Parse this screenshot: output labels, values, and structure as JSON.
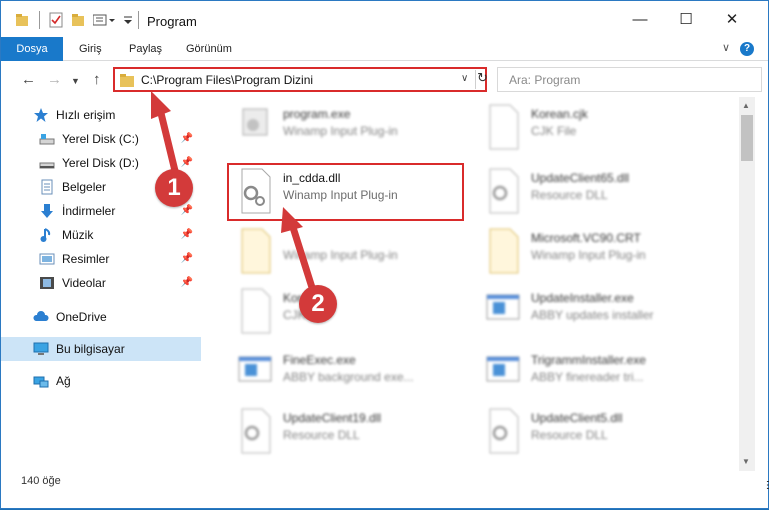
{
  "window": {
    "title": "Program"
  },
  "ribbon": {
    "tabs": [
      "Dosya",
      "Giriş",
      "Paylaş",
      "Görünüm"
    ]
  },
  "address": {
    "path": "C:\\Program Files\\Program Dizini"
  },
  "search": {
    "placeholder": "Ara: Program"
  },
  "sidebar": {
    "quick_access": "Hızlı erişim",
    "items": [
      {
        "label": "Yerel Disk (C:)",
        "icon": "drive-icon",
        "pinned": true
      },
      {
        "label": "Yerel Disk (D:)",
        "icon": "drive-icon",
        "pinned": true
      },
      {
        "label": "Belgeler",
        "icon": "documents-icon",
        "pinned": true
      },
      {
        "label": "İndirmeler",
        "icon": "downloads-icon",
        "pinned": true
      },
      {
        "label": "Müzik",
        "icon": "music-icon",
        "pinned": true
      },
      {
        "label": "Resimler",
        "icon": "pictures-icon",
        "pinned": true
      },
      {
        "label": "Videolar",
        "icon": "videos-icon",
        "pinned": true
      }
    ],
    "onedrive": "OneDrive",
    "this_pc": "Bu bilgisayar",
    "network": "Ağ"
  },
  "files": [
    {
      "name": "program.exe",
      "desc": "Winamp Input Plug-in",
      "icon": "exe-icon",
      "blurred": true
    },
    {
      "name": "Korean.cjk",
      "desc": "CJK File",
      "icon": "file-icon",
      "blurred": true
    },
    {
      "name": "in_cdda.dll",
      "desc": "Winamp Input Plug-in",
      "icon": "dll-gear-icon",
      "blurred": false
    },
    {
      "name": "UpdateClient65.dll",
      "desc": "Resource DLL",
      "icon": "dll-gear-icon",
      "blurred": true
    },
    {
      "name": "",
      "desc": "Winamp Input Plug-in",
      "icon": "folder-file-icon",
      "blurred": true
    },
    {
      "name": "Microsoft.VC90.CRT",
      "desc": "Winamp Input Plug-in",
      "icon": "folder-file-icon",
      "blurred": true
    },
    {
      "name": "Kor",
      "desc": "CJK",
      "icon": "file-icon",
      "blurred": true
    },
    {
      "name": "UpdateInstaller.exe",
      "desc": "ABBY updates installer",
      "icon": "exe-window-icon",
      "blurred": true
    },
    {
      "name": "FineExec.exe",
      "desc": "ABBY background exe...",
      "icon": "exe-window-icon",
      "blurred": true
    },
    {
      "name": "TrigrammInstaller.exe",
      "desc": "ABBY finereader tri...",
      "icon": "exe-window-icon",
      "blurred": true
    },
    {
      "name": "UpdateClient19.dll",
      "desc": "Resource DLL",
      "icon": "dll-gear-icon",
      "blurred": true
    },
    {
      "name": "UpdateClient5.dll",
      "desc": "Resource DLL",
      "icon": "dll-gear-icon",
      "blurred": true
    }
  ],
  "status": {
    "count": "140 öğe"
  },
  "annotations": {
    "step1": "1",
    "step2": "2",
    "color": "#d33a3a"
  }
}
